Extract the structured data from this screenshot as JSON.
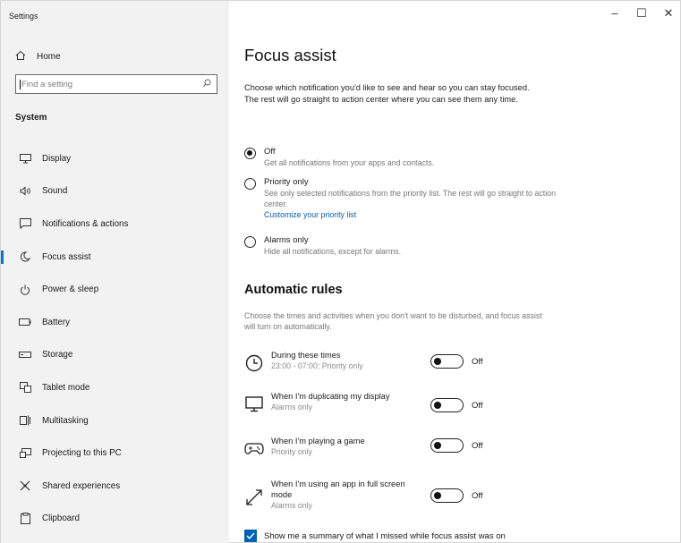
{
  "app": {
    "title": "Settings"
  },
  "window_controls": {
    "minimize": "–",
    "maximize": "☐",
    "close": "✕"
  },
  "sidebar": {
    "home_label": "Home",
    "search_placeholder": "Find a setting",
    "section_label": "System",
    "items": [
      {
        "label": "Display",
        "icon": "monitor-icon"
      },
      {
        "label": "Sound",
        "icon": "speaker-icon"
      },
      {
        "label": "Notifications & actions",
        "icon": "notification-icon"
      },
      {
        "label": "Focus assist",
        "icon": "moon-icon",
        "active": true
      },
      {
        "label": "Power & sleep",
        "icon": "power-icon"
      },
      {
        "label": "Battery",
        "icon": "battery-icon"
      },
      {
        "label": "Storage",
        "icon": "storage-icon"
      },
      {
        "label": "Tablet mode",
        "icon": "tablet-icon"
      },
      {
        "label": "Multitasking",
        "icon": "multitasking-icon"
      },
      {
        "label": "Projecting to this PC",
        "icon": "projector-icon"
      },
      {
        "label": "Shared experiences",
        "icon": "shared-icon"
      },
      {
        "label": "Clipboard",
        "icon": "clipboard-icon"
      }
    ]
  },
  "main": {
    "title": "Focus assist",
    "intro": "Choose which notification you'd like to see and hear so you can stay focused. The rest will go straight to action center where you can see them any time.",
    "options": [
      {
        "label": "Off",
        "desc": "Get all notifications from your apps and contacts.",
        "selected": true
      },
      {
        "label": "Priority only",
        "desc": "See only selected notifications from the priority list. The rest will go straight to action center.",
        "link": "Customize your priority list",
        "selected": false
      },
      {
        "label": "Alarms only",
        "desc": "Hide all notifications, except for alarms.",
        "selected": false
      }
    ],
    "auto_title": "Automatic rules",
    "auto_desc": "Choose the times and activities when you don't want to be disturbed, and focus assist will turn on automatically.",
    "rules": [
      {
        "name": "During these times",
        "sub": "23:00 - 07:00; Priority only",
        "state": "Off",
        "icon": "clock-icon"
      },
      {
        "name": "When I'm duplicating my display",
        "sub": "Alarms only",
        "state": "Off",
        "icon": "display-icon"
      },
      {
        "name": "When I'm playing a game",
        "sub": "Priority only",
        "state": "Off",
        "icon": "gamepad-icon"
      },
      {
        "name": "When I'm using an app in full screen mode",
        "sub": "Alarms only",
        "state": "Off",
        "icon": "fullscreen-icon"
      }
    ],
    "summary_checkbox": {
      "label": "Show me a summary of what I missed while focus assist was on",
      "checked": true
    }
  }
}
